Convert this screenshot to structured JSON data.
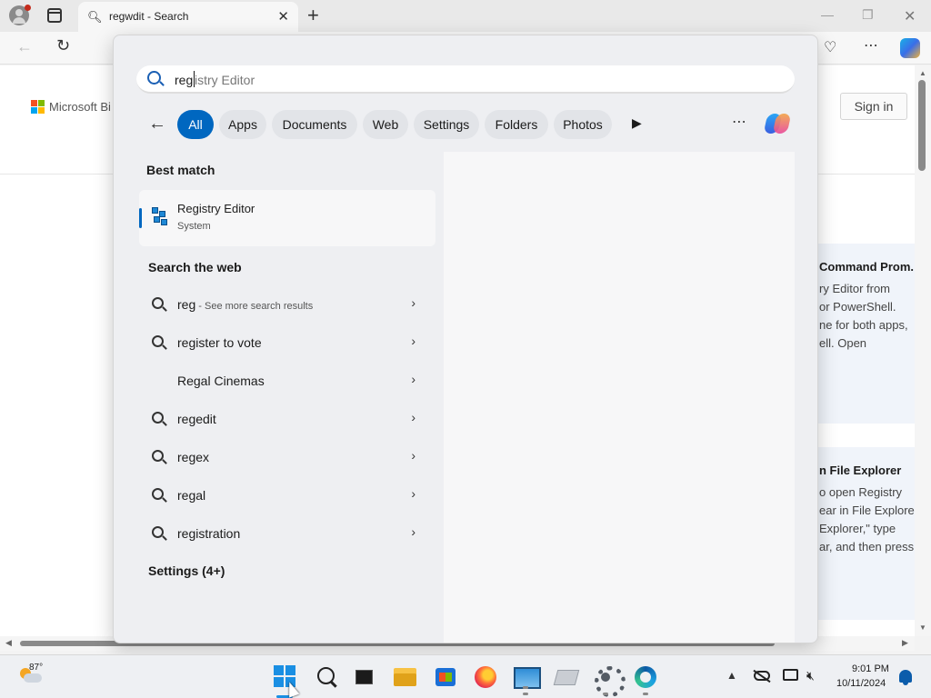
{
  "browser": {
    "tab_title": "regwdit - Search",
    "tab_icon": "search-icon",
    "new_tab_label": "+",
    "window_controls": [
      "minimize",
      "restore",
      "close"
    ]
  },
  "page": {
    "brand": "Microsoft Bi",
    "sign_in": "Sign in",
    "card1": {
      "title": "Command Prom.",
      "lines": [
        "ry Editor from",
        "or PowerShell.",
        "ne for both apps,",
        "ell. Open"
      ]
    },
    "card2": {
      "title": "n File Explorer",
      "lines": [
        "o open Registry",
        "ear in File Explorer",
        "Explorer,\" type",
        "ar, and then press"
      ]
    }
  },
  "search": {
    "typed": "reg",
    "suggestion": "istry Editor",
    "filters": [
      "All",
      "Apps",
      "Documents",
      "Web",
      "Settings",
      "Folders",
      "Photos"
    ],
    "active_filter": "All",
    "best_match_header": "Best match",
    "best_match": {
      "title": "Registry Editor",
      "subtitle": "System",
      "icon": "registry-editor-icon"
    },
    "web_header": "Search the web",
    "web_results": [
      {
        "label": "reg",
        "hint": " - See more search results",
        "icon": "search-icon"
      },
      {
        "label": "register to vote",
        "hint": "",
        "icon": "search-icon"
      },
      {
        "label": "Regal Cinemas",
        "hint": "",
        "icon": ""
      },
      {
        "label": "regedit",
        "hint": "",
        "icon": "search-icon"
      },
      {
        "label": "regex",
        "hint": "",
        "icon": "search-icon"
      },
      {
        "label": "regal",
        "hint": "",
        "icon": "search-icon"
      },
      {
        "label": "registration",
        "hint": "",
        "icon": "search-icon"
      }
    ],
    "settings_header": "Settings (4+)"
  },
  "taskbar": {
    "temperature": "87°",
    "time": "9:01 PM",
    "date": "10/11/2024",
    "apps": [
      "start",
      "search",
      "task-view",
      "file-explorer",
      "microsoft-store",
      "firefox",
      "photos",
      "paper",
      "settings",
      "edge"
    ]
  },
  "colors": {
    "accent": "#0067c0",
    "panel_bg": "#eeeff2",
    "taskbar_bg": "#eef0f3"
  }
}
